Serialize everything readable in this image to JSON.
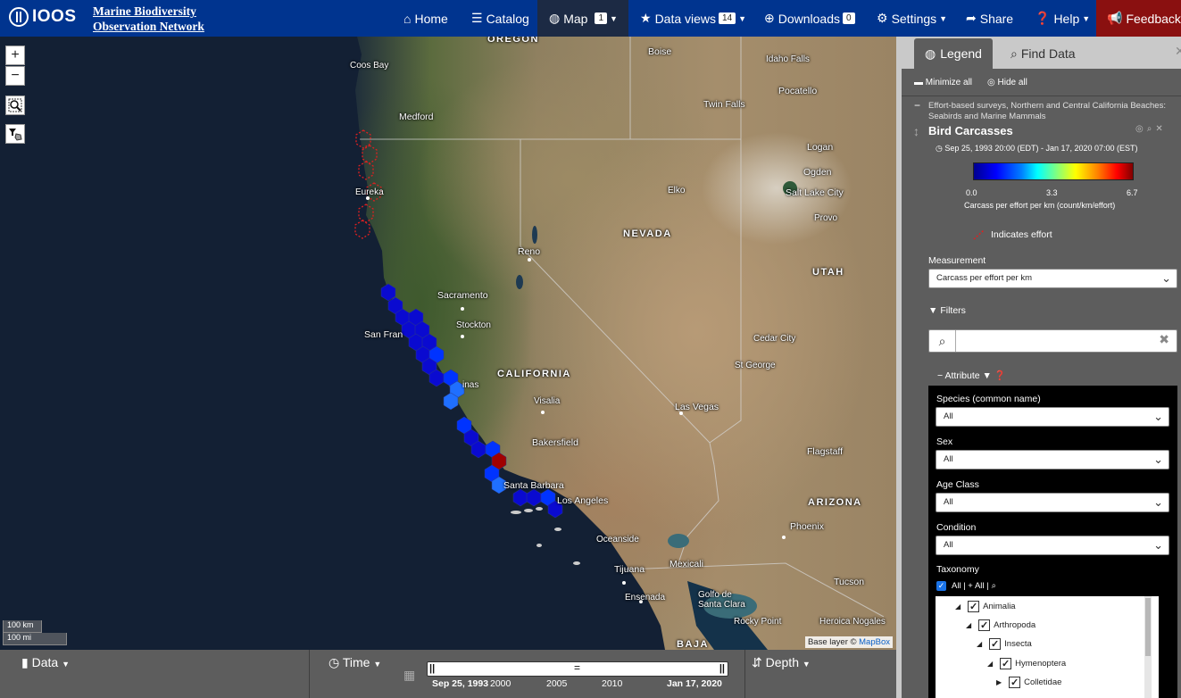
{
  "header": {
    "logo_text": "IOOS",
    "site_title_line1": "Marine Biodiversity",
    "site_title_line2": "Observation Network",
    "nav": {
      "home": "Home",
      "catalog": "Catalog",
      "map": "Map",
      "map_badge": "1",
      "data_views": "Data views",
      "data_views_badge": "14",
      "downloads": "Downloads",
      "downloads_badge": "0",
      "settings": "Settings",
      "share": "Share",
      "help": "Help",
      "feedback": "Feedback"
    }
  },
  "map": {
    "labels": {
      "oregon": "OREGON",
      "boise": "Boise",
      "idaho_falls": "Idaho Falls",
      "coos_bay": "Coos Bay",
      "pocatello": "Pocatello",
      "twin_falls": "Twin Falls",
      "medford": "Medford",
      "logan": "Logan",
      "ogden": "Ogden",
      "salt_lake_city": "Salt Lake City",
      "elko": "Elko",
      "eureka": "Eureka",
      "provo": "Provo",
      "nevada": "NEVADA",
      "reno": "Reno",
      "utah": "UTAH",
      "sacramento": "Sacramento",
      "stockton": "Stockton",
      "san_francisco": "San Fran",
      "cedar_city": "Cedar City",
      "st_george": "St George",
      "california": "CALIFORNIA",
      "salinas": "inas",
      "visalia": "Visalia",
      "las_vegas": "Las Vegas",
      "bakersfield": "Bakersfield",
      "flagstaff": "Flagstaff",
      "santa_barbara": "Santa Barbara",
      "los_angeles": "Los Angeles",
      "arizona": "ARIZONA",
      "oceanside": "Oceanside",
      "phoenix": "Phoenix",
      "tijuana": "Tijuana",
      "mexicali": "Mexicali",
      "ensenada": "Ensenada",
      "tucson": "Tucson",
      "golfo_de_santa_clara": "Golfo de Santa Clara",
      "rocky_point": "Rocky Point",
      "heroica_nogales": "Heroica Nogales",
      "baja": "BAJA"
    },
    "zoom_in": "+",
    "zoom_out": "−",
    "scale_km": "100 km",
    "scale_mi": "100 mi",
    "attribution_prefix": "Base layer ©",
    "attribution_link": "MapBox",
    "hex_colors": {
      "dark_blue": "#0a0ad0",
      "mid_blue": "#0033ff",
      "light_blue": "#1f6fff",
      "dark_red": "#a00000",
      "effort_red": "#e02020"
    }
  },
  "bottombar": {
    "data": "Data",
    "time": "Time",
    "depth": "Depth",
    "timeline_start": "Sep 25, 1993",
    "ticks": [
      "2000",
      "2005",
      "2010"
    ],
    "timeline_end": "Jan 17, 2020"
  },
  "panel": {
    "tab_legend": "Legend",
    "tab_find_data": "Find Data",
    "minimize_all": "Minimize all",
    "hide_all": "Hide all",
    "layer_desc": "Effort-based surveys, Northern and Central California Beaches: Seabirds and Marine Mammals",
    "layer_title": "Bird Carcasses",
    "layer_time": "Sep 25, 1993 20:00 (EDT) - Jan 17, 2020 07:00 (EST)",
    "colorbar_min": "0.0",
    "colorbar_mid": "3.3",
    "colorbar_max": "6.7",
    "colorbar_title": "Carcass per effort per km (count/km/effort)",
    "effort_label": "Indicates effort",
    "measurement_label": "Measurement",
    "measurement_value": "Carcass per effort per km",
    "filters_label": "Filters",
    "attribute_label": "Attribute",
    "species_label": "Species (common name)",
    "species_value": "All",
    "sex_label": "Sex",
    "sex_value": "All",
    "age_label": "Age Class",
    "age_value": "All",
    "condition_label": "Condition",
    "condition_value": "All",
    "taxonomy_label": "Taxonomy",
    "taxonomy_all": "All | + All |",
    "tree": [
      "Animalia",
      "Arthropoda",
      "Insecta",
      "Hymenoptera",
      "Colletidae"
    ]
  }
}
